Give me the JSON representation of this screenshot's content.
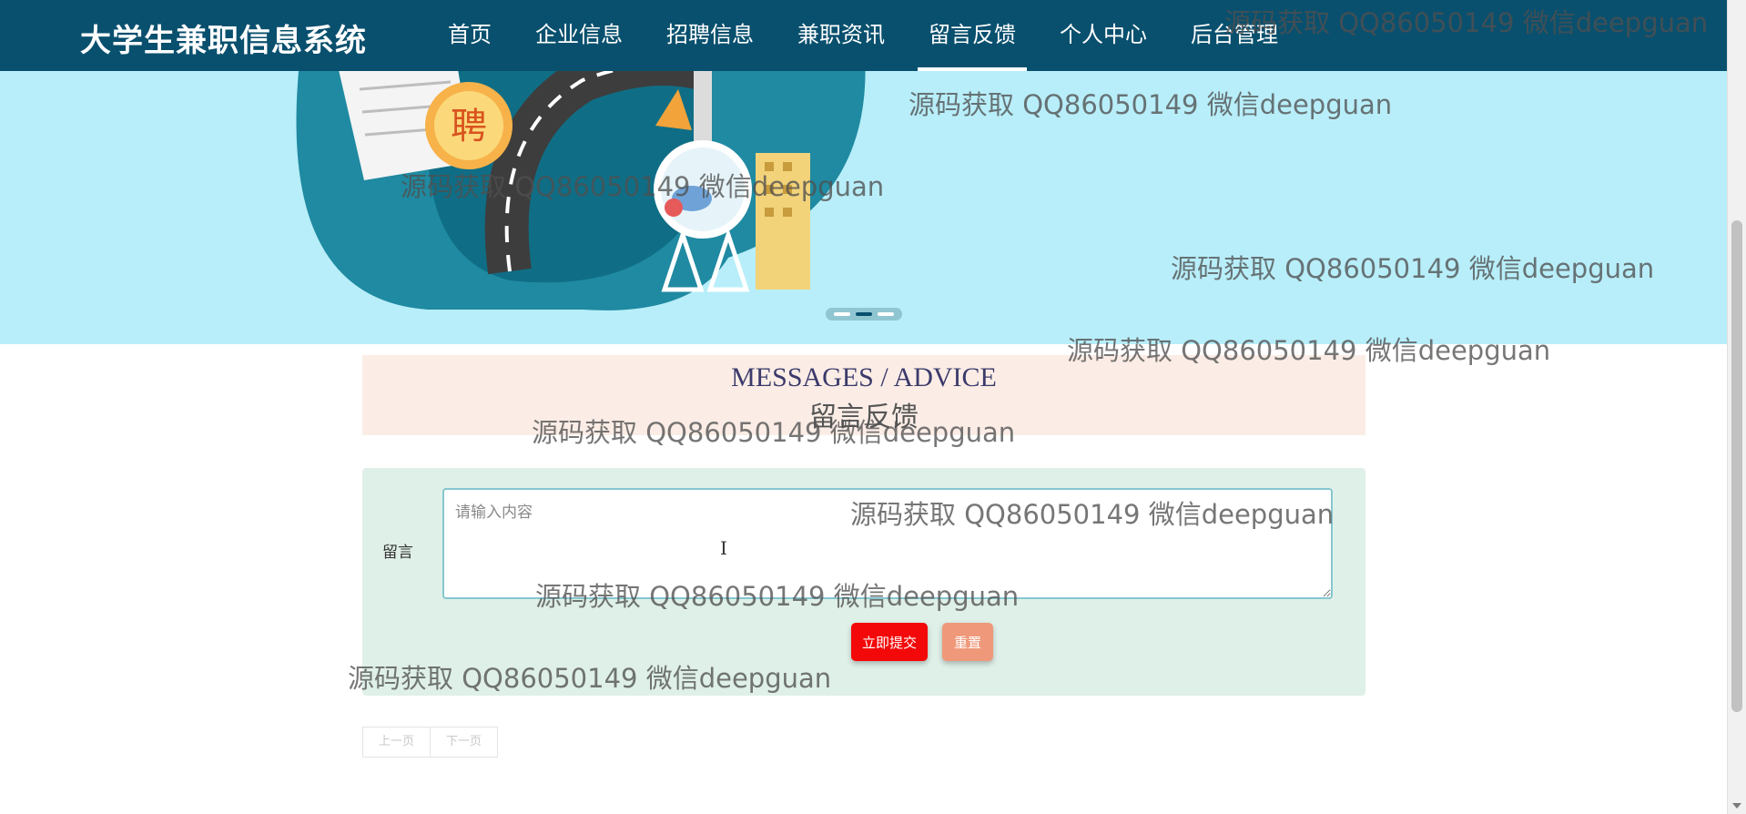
{
  "header": {
    "brand": "大学生兼职信息系统",
    "nav": [
      {
        "label": "首页"
      },
      {
        "label": "企业信息"
      },
      {
        "label": "招聘信息"
      },
      {
        "label": "兼职资讯"
      },
      {
        "label": "留言反馈",
        "active": true
      },
      {
        "label": "个人中心"
      },
      {
        "label": "后台管理"
      }
    ]
  },
  "banner": {
    "badge_char": "聘",
    "carousel_dots": 3,
    "carousel_active_index": 1
  },
  "section": {
    "title_en": "MESSAGES / ADVICE",
    "title_cn": "留言反馈"
  },
  "form": {
    "label": "留言",
    "placeholder": "请输入内容",
    "value": "",
    "submit_label": "立即提交",
    "reset_label": "重置"
  },
  "pager": {
    "prev_label": "上一页",
    "next_label": "下一页"
  },
  "watermark": {
    "text": "源码获取 QQ86050149 微信deepguan"
  },
  "colors": {
    "header_bg": "#09506e",
    "banner_bg": "#b8eef9",
    "title_bg": "#fbede6",
    "form_bg": "#dff0e8",
    "submit_bg": "#f30909",
    "reset_bg": "#f0987a"
  }
}
